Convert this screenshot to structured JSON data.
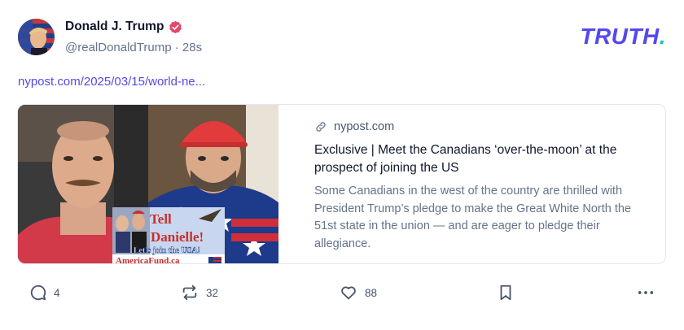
{
  "post": {
    "author_name": "Donald J. Trump",
    "handle": "@realDonaldTrump",
    "separator": "·",
    "time_ago": "28s",
    "link_text": "nypost.com/2025/03/15/world-ne..."
  },
  "brand": {
    "name": "TRUTH",
    "dot": "."
  },
  "card": {
    "domain": "nypost.com",
    "headline": "Exclusive | Meet the Canadians ‘over-the-moon’ at the prospect of joining the US",
    "description": "Some Canadians in the west of the country are thrilled with President Trump’s pledge to make the Great White North the 51st state in the union — and are eager to pledge their allegiance.",
    "image_sign": {
      "line1": "Tell",
      "line2": "Danielle!",
      "line3": "Let's join the USA!",
      "line4": "AmericaFund.ca"
    }
  },
  "actions": {
    "replies": "4",
    "retruths": "32",
    "likes": "88"
  },
  "icons": {
    "verified": "verified-badge-icon",
    "reply": "speech-bubble-icon",
    "retruth": "repost-arrows-icon",
    "like": "heart-icon",
    "bookmark": "bookmark-icon",
    "more": "ellipsis-icon",
    "link": "chain-link-icon"
  },
  "colors": {
    "brand_purple": "#5448ee",
    "brand_teal": "#10c8c0",
    "verified": "#e2476a",
    "link": "#5448ee"
  }
}
